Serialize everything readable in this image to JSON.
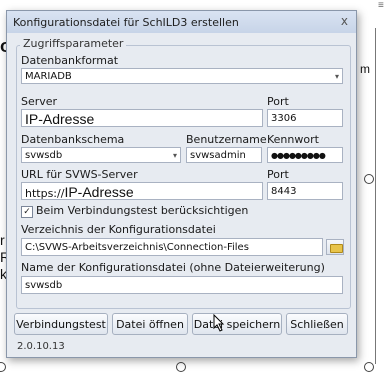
{
  "background": {
    "left_fragments": [
      "o-",
      "r",
      "RV",
      "k"
    ],
    "right_fragment": "m",
    "top_right_glyph": "≡"
  },
  "dialog": {
    "title": "Konfigurationsdatei für SchILD3 erstellen",
    "close_glyph": "x",
    "group_title": "Zugriffsparameter",
    "datenbankformat": {
      "label": "Datenbankformat",
      "value": "MARIADB"
    },
    "server": {
      "label": "Server",
      "value": "IP-Adresse"
    },
    "port1": {
      "label": "Port",
      "value": "3306"
    },
    "schema": {
      "label": "Datenbankschema",
      "value": "svwsdb"
    },
    "benutzername": {
      "label": "Benutzername",
      "value": "svwsadmin"
    },
    "kennwort": {
      "label": "Kennwort",
      "value": "●●●●●●●●●"
    },
    "url": {
      "label": "URL für SVWS-Server",
      "prefix": "https://",
      "value": "IP-Adresse"
    },
    "port2": {
      "label": "Port",
      "value": "8443"
    },
    "checkbox": {
      "label": "Beim Verbindungstest berücksichtigen",
      "checked": true
    },
    "verzeichnis": {
      "label": "Verzeichnis der Konfigurationsdatei",
      "value": "C:\\SVWS-Arbeitsverzeichnis\\Connection-Files"
    },
    "dateiname": {
      "label": "Name der Konfigurationsdatei (ohne Dateierweiterung)",
      "value": "svwsdb"
    },
    "buttons": {
      "test": "Verbindungstest",
      "open": "Datei öffnen",
      "save": "Datei speichern",
      "close": "Schließen"
    },
    "version": "2.0.10.13"
  },
  "colors": {
    "dialog_bg": "#e7ebf1",
    "titlebar": "#c7d4e8",
    "folder_icon": "#e8c44a"
  }
}
